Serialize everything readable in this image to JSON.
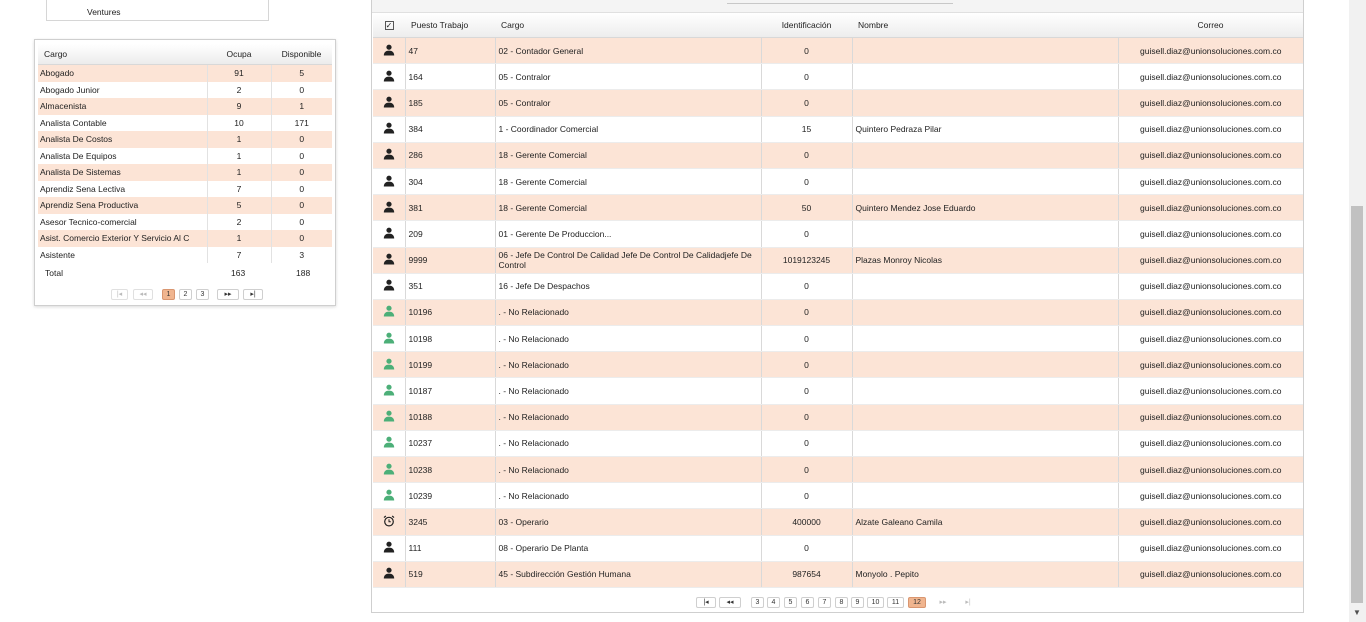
{
  "company": {
    "name": "Ventures"
  },
  "summary": {
    "headers": [
      "Cargo",
      "Ocupa",
      "Disponible"
    ],
    "rows": [
      [
        "Abogado",
        "91",
        "5"
      ],
      [
        "Abogado Junior",
        "2",
        "0"
      ],
      [
        "Almacenista",
        "9",
        "1"
      ],
      [
        "Analista Contable",
        "10",
        "171"
      ],
      [
        "Analista De Costos",
        "1",
        "0"
      ],
      [
        "Analista De Equipos",
        "1",
        "0"
      ],
      [
        "Analista De Sistemas",
        "1",
        "0"
      ],
      [
        "Aprendiz Sena Lectiva",
        "7",
        "0"
      ],
      [
        "Aprendiz Sena Productiva",
        "5",
        "0"
      ],
      [
        "Asesor Tecnico-comercial",
        "2",
        "0"
      ],
      [
        "Asist. Comercio Exterior Y Servicio Al C",
        "1",
        "0"
      ],
      [
        "Asistente",
        "7",
        "3"
      ]
    ],
    "total_label": "Total",
    "total_ocupa": "163",
    "total_disponible": "188",
    "pager": {
      "first": "|◂",
      "prev": "◂◂",
      "pages": [
        "1",
        "2",
        "3"
      ],
      "active": "1",
      "next": "▸▸",
      "last": "▸|"
    }
  },
  "grid": {
    "headers": {
      "select_all": "✓",
      "puesto": "Puesto Trabajo",
      "cargo": "Cargo",
      "identificacion": "Identificación",
      "nombre": "Nombre",
      "correo": "Correo"
    },
    "rows": [
      {
        "icon": "user-dark-icon",
        "puesto": "47",
        "cargo": "02 - Contador General",
        "id": "0",
        "nombre": "",
        "correo": "guisell.diaz@unionsoluciones.com.co"
      },
      {
        "icon": "user-dark-icon",
        "puesto": "164",
        "cargo": "05 - Contralor",
        "id": "0",
        "nombre": "",
        "correo": "guisell.diaz@unionsoluciones.com.co"
      },
      {
        "icon": "user-dark-icon",
        "puesto": "185",
        "cargo": "05 - Contralor",
        "id": "0",
        "nombre": "",
        "correo": "guisell.diaz@unionsoluciones.com.co"
      },
      {
        "icon": "user-dark-icon",
        "puesto": "384",
        "cargo": "1 - Coordinador Comercial",
        "id": "15",
        "nombre": "Quintero Pedraza Pilar",
        "correo": "guisell.diaz@unionsoluciones.com.co"
      },
      {
        "icon": "user-dark-icon",
        "puesto": "286",
        "cargo": "18 - Gerente Comercial",
        "id": "0",
        "nombre": "",
        "correo": "guisell.diaz@unionsoluciones.com.co"
      },
      {
        "icon": "user-dark-icon",
        "puesto": "304",
        "cargo": "18 - Gerente Comercial",
        "id": "0",
        "nombre": "",
        "correo": "guisell.diaz@unionsoluciones.com.co"
      },
      {
        "icon": "user-dark-icon",
        "puesto": "381",
        "cargo": "18 - Gerente Comercial",
        "id": "50",
        "nombre": "Quintero Mendez Jose Eduardo",
        "correo": "guisell.diaz@unionsoluciones.com.co"
      },
      {
        "icon": "user-dark-icon",
        "puesto": "209",
        "cargo": "01 - Gerente De Produccion...",
        "id": "0",
        "nombre": "",
        "correo": "guisell.diaz@unionsoluciones.com.co"
      },
      {
        "icon": "user-dark-icon",
        "puesto": "9999",
        "cargo": "06 - Jefe De Control De Calidad Jefe De Control De Calidadjefe De Control",
        "id": "1019123245",
        "nombre": "Plazas Monroy Nicolas",
        "correo": "guisell.diaz@unionsoluciones.com.co"
      },
      {
        "icon": "user-dark-icon",
        "puesto": "351",
        "cargo": "16 - Jefe De Despachos",
        "id": "0",
        "nombre": "",
        "correo": "guisell.diaz@unionsoluciones.com.co"
      },
      {
        "icon": "user-green-icon",
        "puesto": "10196",
        "cargo": ". - No Relacionado",
        "id": "0",
        "nombre": "",
        "correo": "guisell.diaz@unionsoluciones.com.co"
      },
      {
        "icon": "user-green-icon",
        "puesto": "10198",
        "cargo": ". - No Relacionado",
        "id": "0",
        "nombre": "",
        "correo": "guisell.diaz@unionsoluciones.com.co"
      },
      {
        "icon": "user-green-icon",
        "puesto": "10199",
        "cargo": ". - No Relacionado",
        "id": "0",
        "nombre": "",
        "correo": "guisell.diaz@unionsoluciones.com.co"
      },
      {
        "icon": "user-green-icon",
        "puesto": "10187",
        "cargo": ". - No Relacionado",
        "id": "0",
        "nombre": "",
        "correo": "guisell.diaz@unionsoluciones.com.co"
      },
      {
        "icon": "user-green-icon",
        "puesto": "10188",
        "cargo": ". - No Relacionado",
        "id": "0",
        "nombre": "",
        "correo": "guisell.diaz@unionsoluciones.com.co"
      },
      {
        "icon": "user-green-icon",
        "puesto": "10237",
        "cargo": ". - No Relacionado",
        "id": "0",
        "nombre": "",
        "correo": "guisell.diaz@unionsoluciones.com.co"
      },
      {
        "icon": "user-green-icon",
        "puesto": "10238",
        "cargo": ". - No Relacionado",
        "id": "0",
        "nombre": "",
        "correo": "guisell.diaz@unionsoluciones.com.co"
      },
      {
        "icon": "user-green-icon",
        "puesto": "10239",
        "cargo": ". - No Relacionado",
        "id": "0",
        "nombre": "",
        "correo": "guisell.diaz@unionsoluciones.com.co"
      },
      {
        "icon": "alarm-clock-icon",
        "puesto": "3245",
        "cargo": "03 - Operario",
        "id": "400000",
        "nombre": "Alzate Galeano Camila",
        "correo": "guisell.diaz@unionsoluciones.com.co"
      },
      {
        "icon": "user-dark-icon",
        "puesto": "111",
        "cargo": "08 - Operario De Planta",
        "id": "0",
        "nombre": "",
        "correo": "guisell.diaz@unionsoluciones.com.co"
      },
      {
        "icon": "user-dark-icon",
        "puesto": "519",
        "cargo": "45 - Subdirección Gestión Humana",
        "id": "987654",
        "nombre": "Monyolo . Pepito",
        "correo": "guisell.diaz@unionsoluciones.com.co"
      }
    ],
    "pager": {
      "first": "|◂",
      "prev": "◂◂",
      "pages": [
        "3",
        "4",
        "5",
        "6",
        "7",
        "8",
        "9",
        "10",
        "11",
        "12"
      ],
      "active": "12",
      "next": "▸▸",
      "last": "▸|"
    }
  },
  "colors": {
    "row_highlight": "#fce4d6",
    "pager_active": "#f0b58f",
    "icon_dark": "#222222",
    "icon_green": "#4caf78"
  }
}
